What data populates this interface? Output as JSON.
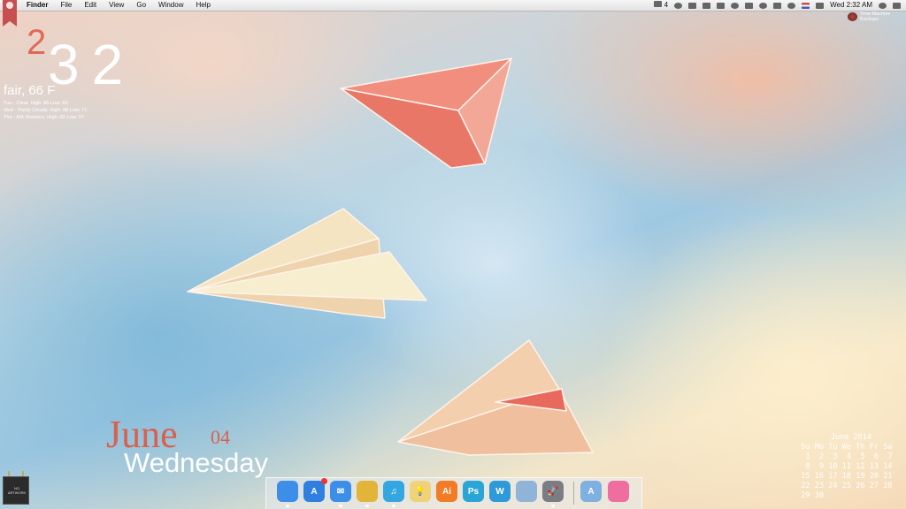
{
  "menubar": {
    "app_name": "Finder",
    "menus": [
      "File",
      "Edit",
      "View",
      "Go",
      "Window",
      "Help"
    ],
    "status_text": "4",
    "datetime": "Wed 2:32 AM"
  },
  "clock": {
    "hour": "2",
    "minutes": "32"
  },
  "weather": {
    "current": "fair, 66 F",
    "forecast": [
      "Tue - Clear. High: 86 Low: 66",
      "Wed - Partly Cloudy. High: 88 Low: 71",
      "Thu - AM Showers. High: 82 Low: 57"
    ]
  },
  "date_widget": {
    "month": "June",
    "day": "04",
    "weekday": "Wednesday"
  },
  "time_machine": {
    "label": "Time Machine Backups"
  },
  "album": {
    "text": "NO ARTWORK"
  },
  "calendar": {
    "title": "June 2014",
    "weekdays": [
      "Su",
      "Mo",
      "Tu",
      "We",
      "Th",
      "Fr",
      "Sa"
    ],
    "weeks": [
      [
        "1",
        "2",
        "3",
        "4",
        "5",
        "6",
        "7"
      ],
      [
        "8",
        "9",
        "10",
        "11",
        "12",
        "13",
        "14"
      ],
      [
        "15",
        "16",
        "17",
        "18",
        "19",
        "20",
        "21"
      ],
      [
        "22",
        "23",
        "24",
        "25",
        "26",
        "27",
        "28"
      ],
      [
        "29",
        "30",
        "",
        "",
        "",
        "",
        ""
      ]
    ]
  },
  "dock": {
    "apps": [
      {
        "name": "Finder",
        "glyph": "",
        "color": "#3d8ee8"
      },
      {
        "name": "App Store",
        "glyph": "A",
        "color": "#2f7fe0"
      },
      {
        "name": "Mail",
        "glyph": "✉",
        "color": "#3c8ee8"
      },
      {
        "name": "Chrome",
        "glyph": "",
        "color": "#e3b43a"
      },
      {
        "name": "iTunes",
        "glyph": "♫",
        "color": "#35a7e0"
      },
      {
        "name": "Tips",
        "glyph": "💡",
        "color": "#f0d27a"
      },
      {
        "name": "Illustrator",
        "glyph": "Ai",
        "color": "#f27c25"
      },
      {
        "name": "Photoshop",
        "glyph": "Ps",
        "color": "#2aa6d6"
      },
      {
        "name": "Word",
        "glyph": "W",
        "color": "#2f9ad9"
      },
      {
        "name": "Preview",
        "glyph": "",
        "color": "#8fb4d8"
      },
      {
        "name": "Launchpad",
        "glyph": "🚀",
        "color": "#7a7d83"
      },
      {
        "name": "Applications",
        "glyph": "A",
        "color": "#7eb0e0"
      },
      {
        "name": "Downloads",
        "glyph": "",
        "color": "#ef6ea0"
      }
    ]
  },
  "colors": {
    "accent": "#d8614e",
    "menubar": "#ececec"
  }
}
